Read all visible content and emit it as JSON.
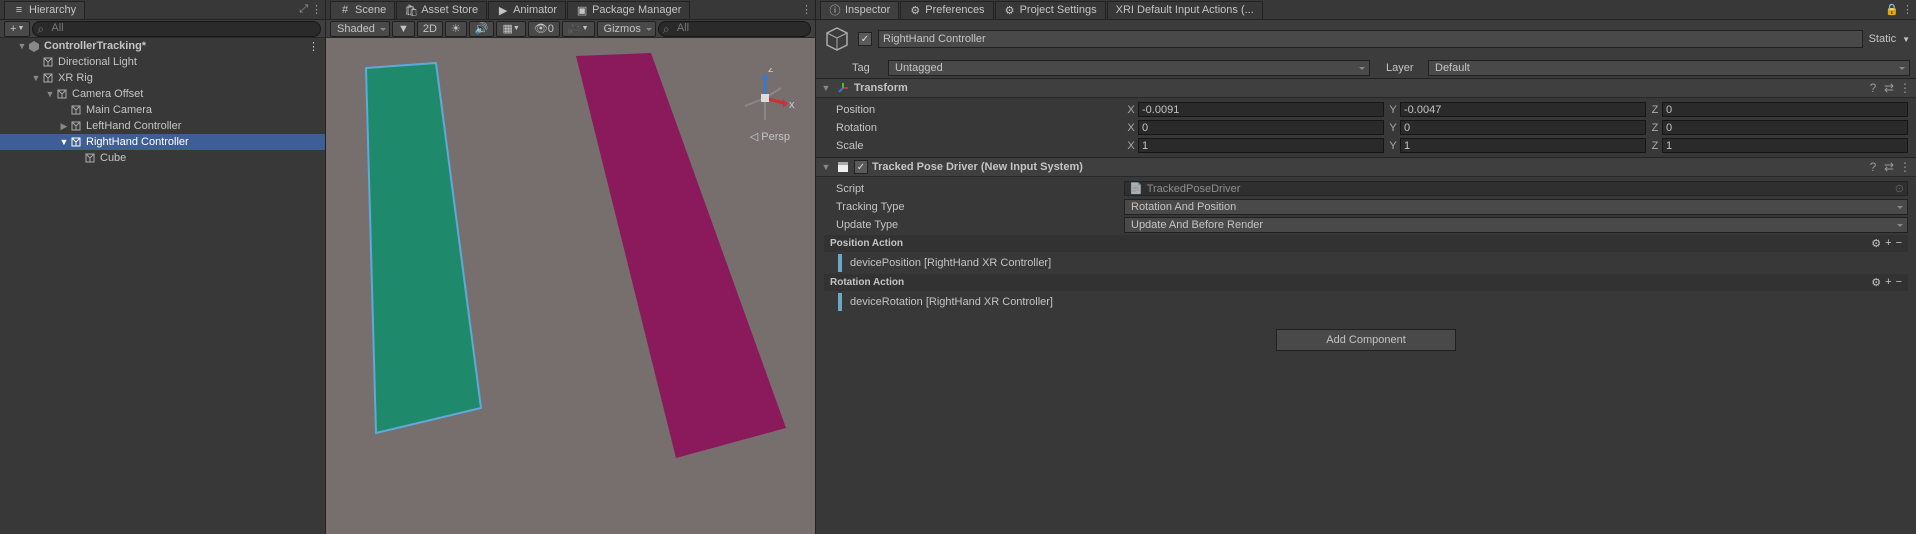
{
  "hierarchy": {
    "tab": "Hierarchy",
    "searchPlaceholder": "All",
    "scene": "ControllerTracking*",
    "items": {
      "dirLight": "Directional Light",
      "xrRig": "XR Rig",
      "camOffset": "Camera Offset",
      "mainCam": "Main Camera",
      "leftHand": "LeftHand Controller",
      "rightHand": "RightHand Controller",
      "cube": "Cube"
    }
  },
  "sceneTabs": {
    "scene": "Scene",
    "assetStore": "Asset Store",
    "animator": "Animator",
    "packageMgr": "Package Manager"
  },
  "sceneToolbar": {
    "shading": "Shaded",
    "twoD": "2D",
    "gizmos": "Gizmos",
    "searchPlaceholder": "All",
    "perspLabel": "Persp"
  },
  "inspTabs": {
    "inspector": "Inspector",
    "prefs": "Preferences",
    "projSettings": "Project Settings",
    "xriActions": "XRI Default Input Actions (..."
  },
  "obj": {
    "name": "RightHand Controller",
    "staticLabel": "Static",
    "tagLabel": "Tag",
    "tagValue": "Untagged",
    "layerLabel": "Layer",
    "layerValue": "Default"
  },
  "transform": {
    "title": "Transform",
    "pos": {
      "label": "Position",
      "x": "-0.0091",
      "y": "-0.0047",
      "z": "0"
    },
    "rot": {
      "label": "Rotation",
      "x": "0",
      "y": "0",
      "z": "0"
    },
    "scl": {
      "label": "Scale",
      "x": "1",
      "y": "1",
      "z": "1"
    }
  },
  "tpd": {
    "title": "Tracked Pose Driver (New Input System)",
    "scriptLabel": "Script",
    "scriptValue": "TrackedPoseDriver",
    "trackTypeLabel": "Tracking Type",
    "trackTypeValue": "Rotation And Position",
    "updateTypeLabel": "Update Type",
    "updateTypeValue": "Update And Before Render",
    "posAction": "Position Action",
    "posBinding": "devicePosition [RightHand XR Controller]",
    "rotAction": "Rotation Action",
    "rotBinding": "deviceRotation [RightHand XR Controller]"
  },
  "addComponent": "Add Component"
}
